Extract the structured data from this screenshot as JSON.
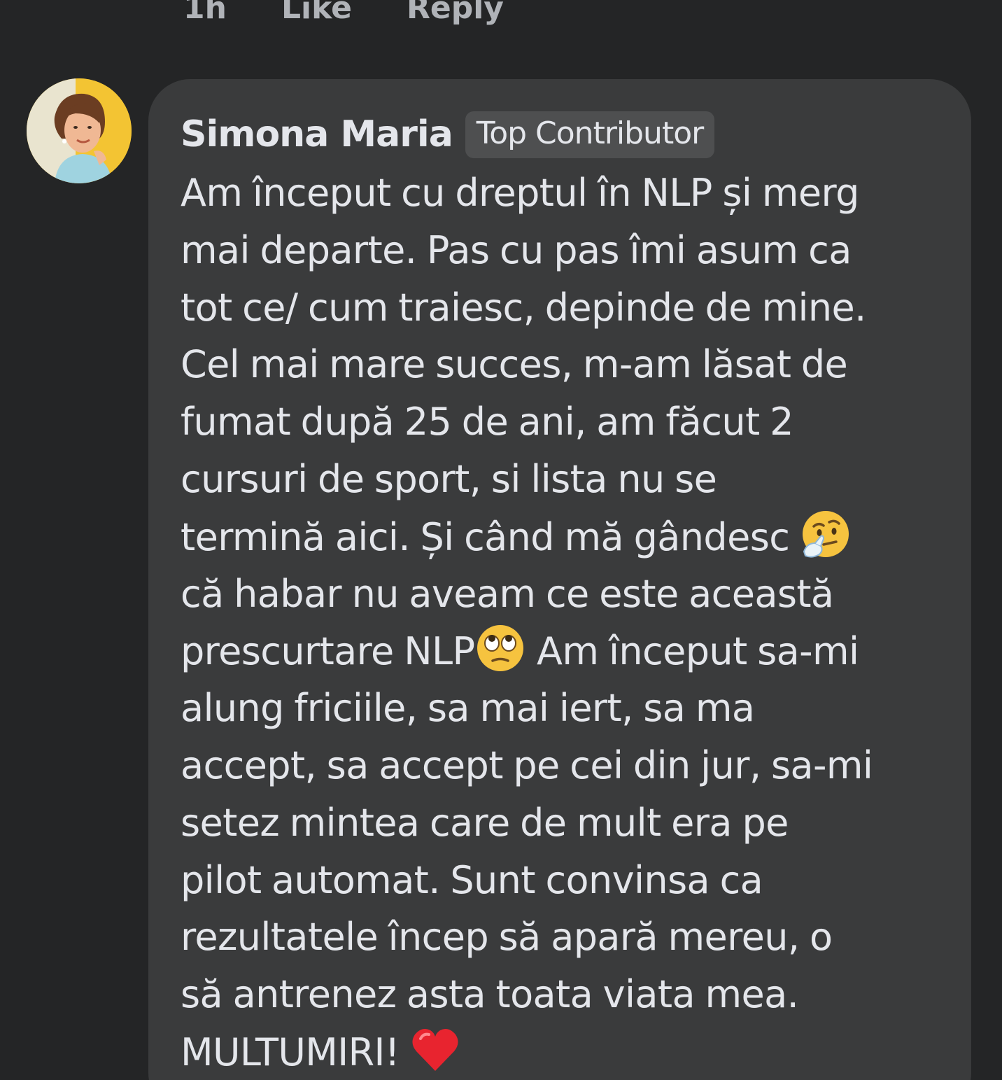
{
  "previous_comment_actions": {
    "time": "1h",
    "like": "Like",
    "reply": "Reply"
  },
  "comment": {
    "author": "Simona Maria",
    "badge": "Top Contributor",
    "lines": [
      "Am început cu dreptul în NLP și merg",
      "mai departe. Pas cu pas îmi asum ca",
      "tot ce/ cum traiesc, depinde de mine.",
      "Cel mai mare succes, m-am lăsat de",
      "fumat după 25 de ani, am făcut 2",
      "cursuri de sport, si lista nu se",
      "termină aici. Și când mă gândesc",
      "că habar nu aveam ce este această",
      "prescurtare NLP",
      " Am început sa-mi",
      "alung friciile, sa mai iert, sa ma",
      "accept, sa accept pe cei din jur, sa-mi",
      "setez mintea care de mult era pe",
      "pilot automat. Sunt convinsa ca",
      "rezultatele încep să apară mereu, o",
      "să antrenez asta toata viata mea.",
      "MULTUMIRI!"
    ],
    "emojis": [
      "thinking-face",
      "face-with-rolling-eyes",
      "red-heart"
    ]
  },
  "colors": {
    "background": "#242526",
    "bubble": "#3a3b3c",
    "text": "#e4e6eb",
    "secondary_text": "#b0b3b8",
    "badge_bg": "#4e4f50"
  }
}
